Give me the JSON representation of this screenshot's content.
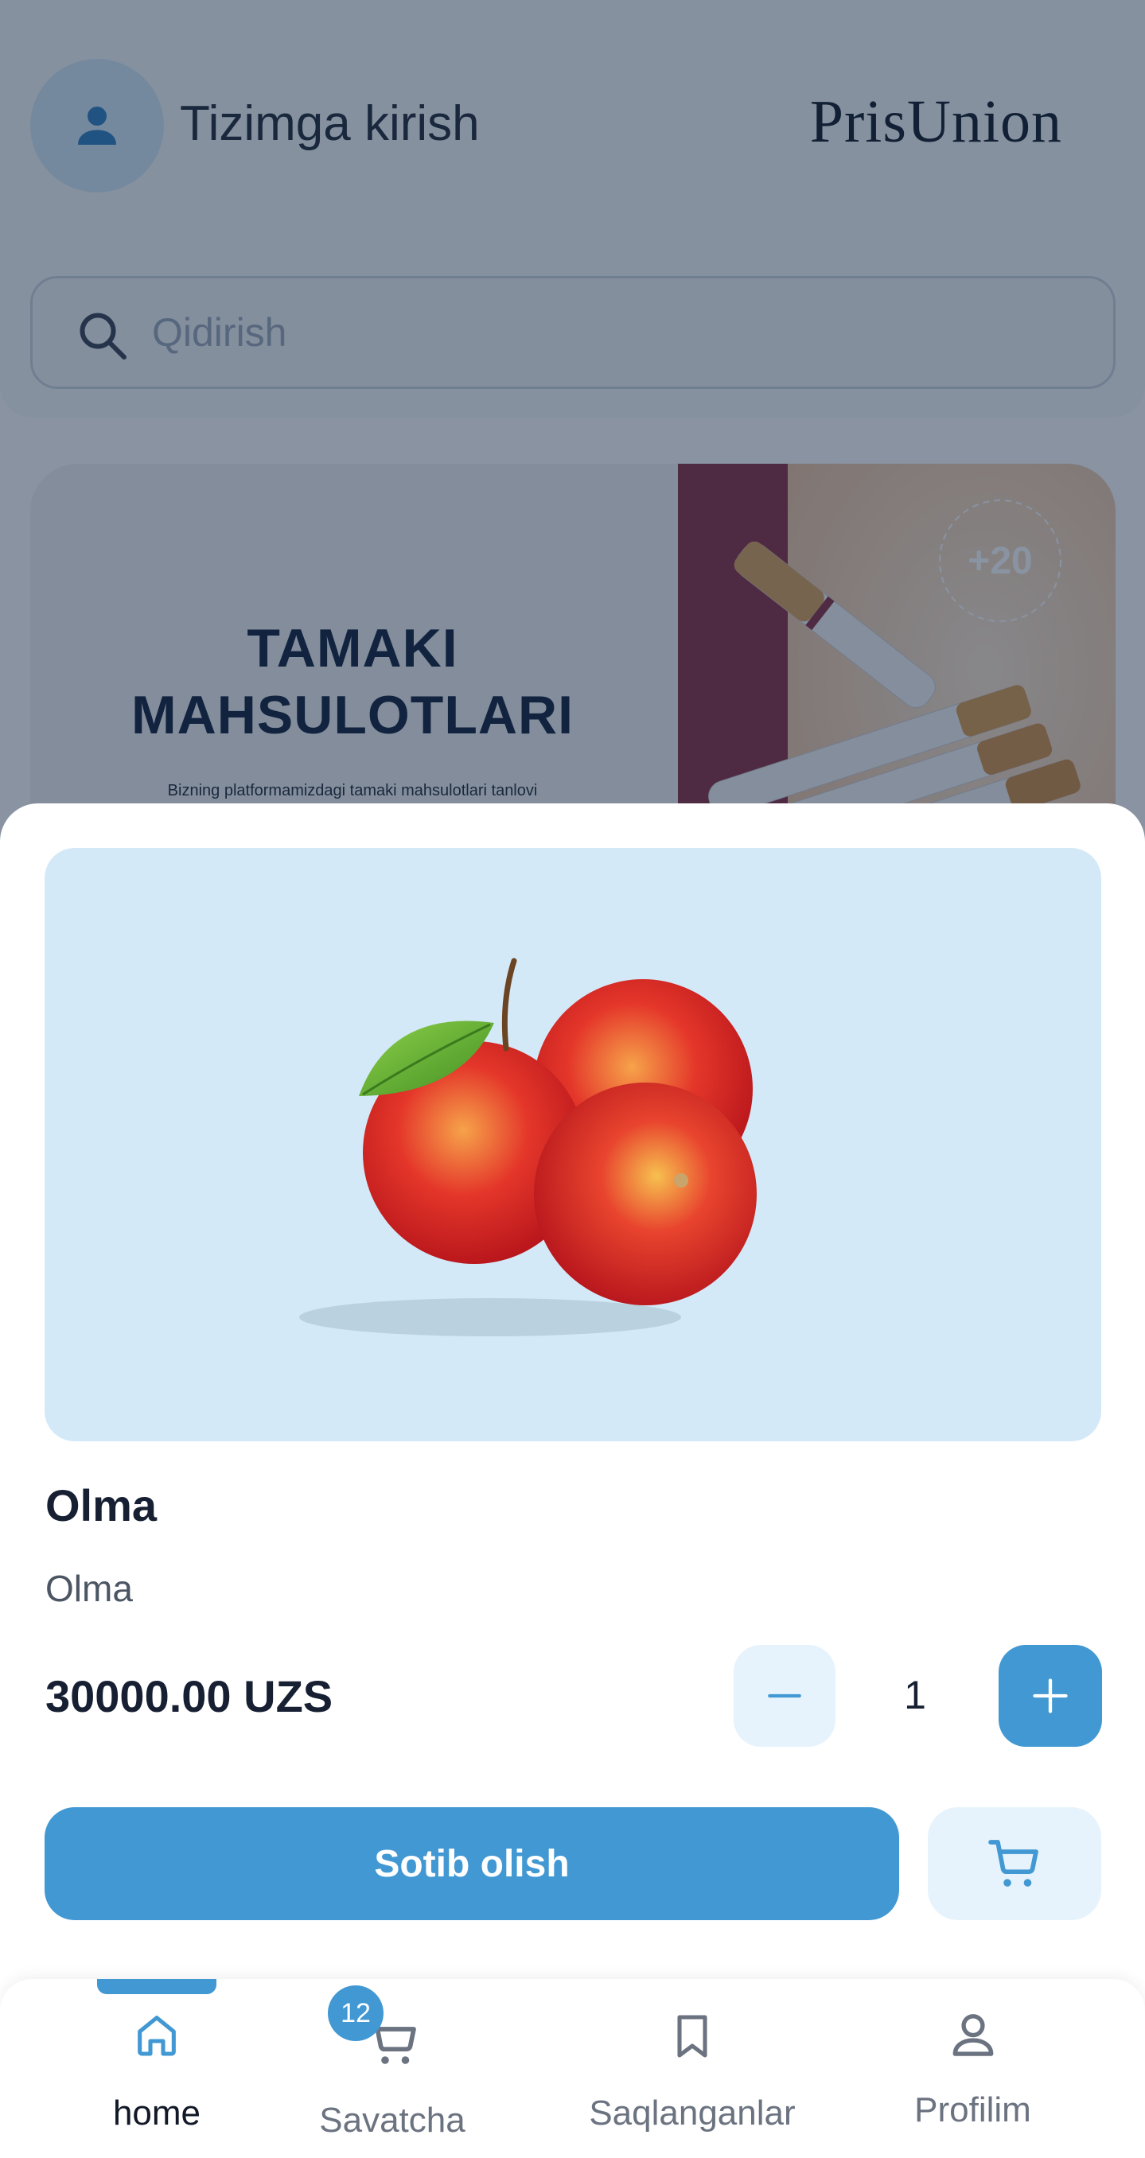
{
  "header": {
    "login_text": "Tizimga kirish",
    "logo_text": "PrisUnion",
    "search_placeholder": "Qidirish"
  },
  "banner": {
    "title_line1": "TAMAKI",
    "title_line2": "MAHSULOTLARI",
    "subtitle": "Bizning platformamizdagi tamaki mahsulotlari tanlovi",
    "age_badge": "+20"
  },
  "product": {
    "title": "Olma",
    "description": "Olma",
    "price": "30000.00 UZS",
    "quantity": "1",
    "buy_label": "Sotib olish"
  },
  "bottom_nav": {
    "items": [
      {
        "label": "home",
        "icon": "home-icon",
        "active": true
      },
      {
        "label": "Savatcha",
        "icon": "cart-icon",
        "badge": "12"
      },
      {
        "label": "Saqlanganlar",
        "icon": "bookmark-icon"
      },
      {
        "label": "Profilim",
        "icon": "user-icon"
      }
    ]
  },
  "colors": {
    "accent": "#4198d3",
    "accent_light": "#e6f3fc",
    "product_bg": "#d4e9f8",
    "text_dark": "#172033",
    "overlay": "rgba(20,40,68,0.50)"
  }
}
